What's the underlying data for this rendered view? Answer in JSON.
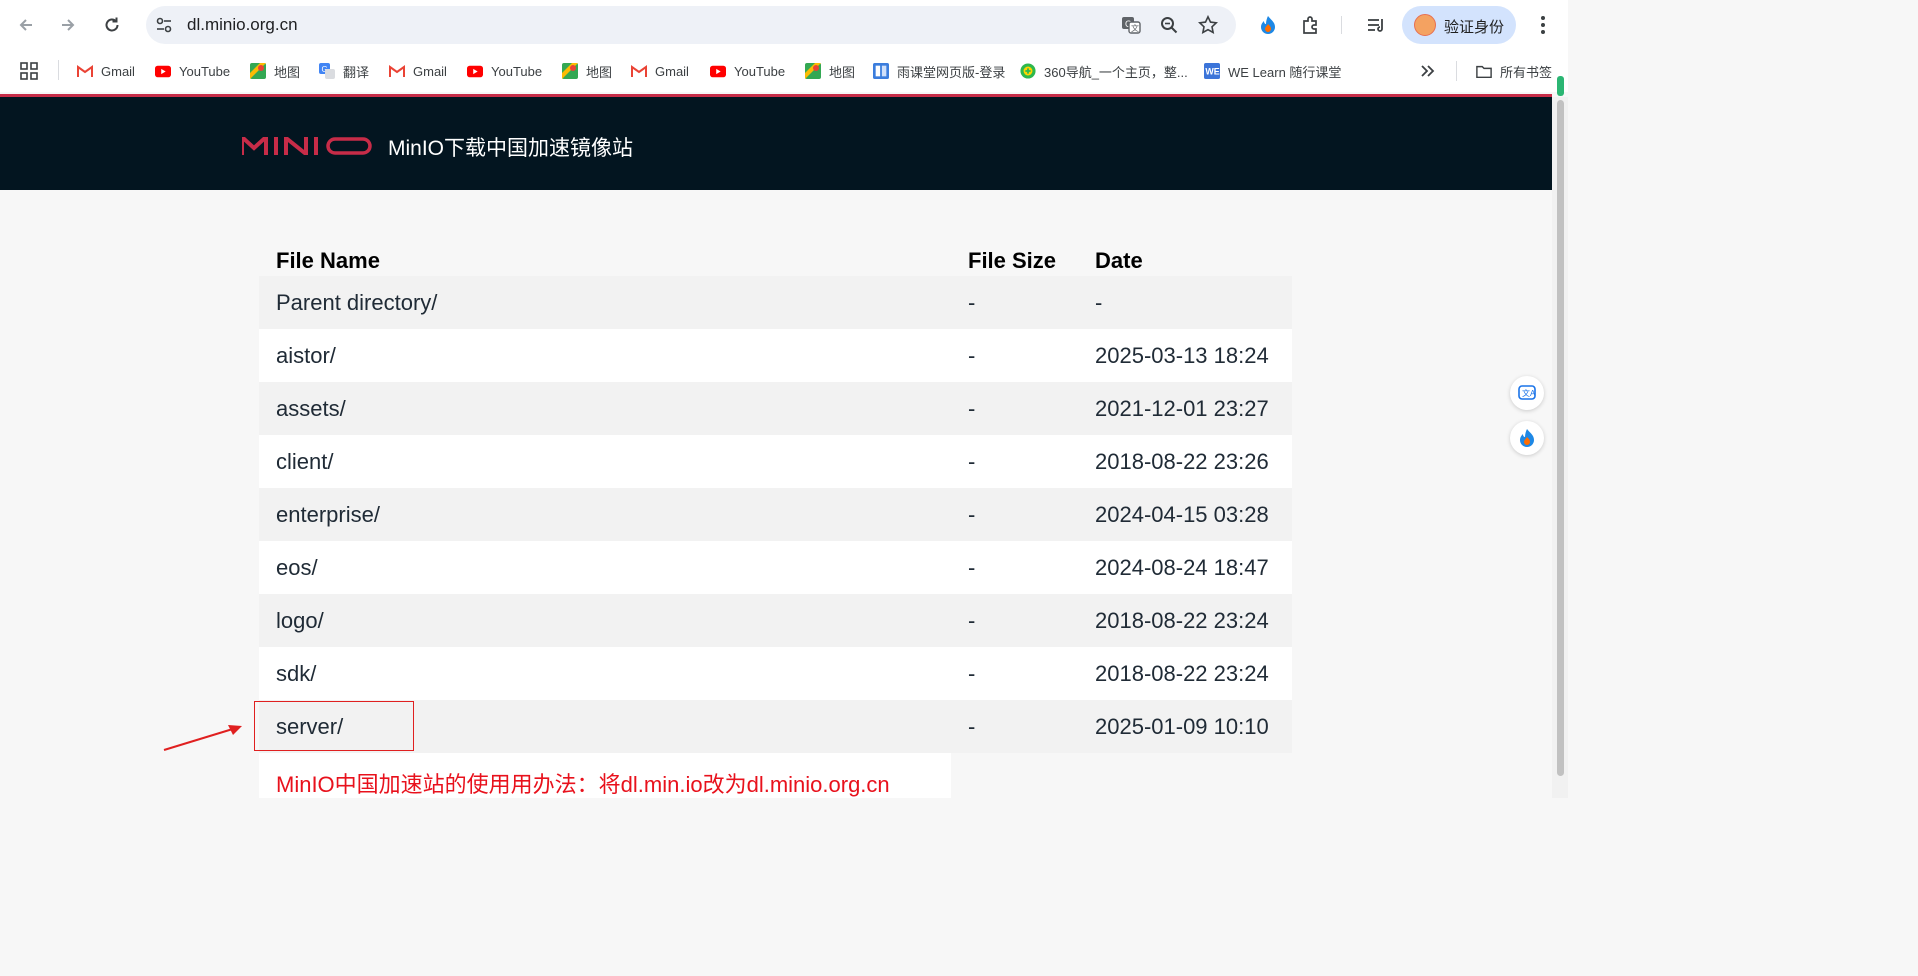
{
  "browser": {
    "url": "dl.minio.org.cn",
    "profile_label": "验证身份",
    "bookmarks": [
      {
        "label": "Gmail",
        "icon": "gmail-icon"
      },
      {
        "label": "YouTube",
        "icon": "youtube-icon"
      },
      {
        "label": "地图",
        "icon": "maps-icon"
      },
      {
        "label": "翻译",
        "icon": "translate-icon"
      },
      {
        "label": "Gmail",
        "icon": "gmail-icon"
      },
      {
        "label": "YouTube",
        "icon": "youtube-icon"
      },
      {
        "label": "地图",
        "icon": "maps-icon"
      },
      {
        "label": "Gmail",
        "icon": "gmail-icon"
      },
      {
        "label": "YouTube",
        "icon": "youtube-icon"
      },
      {
        "label": "地图",
        "icon": "maps-icon"
      },
      {
        "label": "雨课堂网页版-登录",
        "icon": "rain-classroom-icon"
      },
      {
        "label": "360导航_一个主页，整...",
        "icon": "360-icon"
      },
      {
        "label": "WE Learn 随行课堂",
        "icon": "welearn-icon"
      }
    ],
    "all_bookmarks_label": "所有书签"
  },
  "site": {
    "logo_text": "MINIO",
    "title": "MinIO下载中国加速镜像站"
  },
  "table": {
    "headers": {
      "name": "File Name",
      "size": "File Size",
      "date": "Date"
    },
    "rows": [
      {
        "name": "Parent directory/",
        "size": "-",
        "date": "-"
      },
      {
        "name": "aistor/",
        "size": "-",
        "date": "2025-03-13 18:24"
      },
      {
        "name": "assets/",
        "size": "-",
        "date": "2021-12-01 23:27"
      },
      {
        "name": "client/",
        "size": "-",
        "date": "2018-08-22 23:26"
      },
      {
        "name": "enterprise/",
        "size": "-",
        "date": "2024-04-15 03:28"
      },
      {
        "name": "eos/",
        "size": "-",
        "date": "2024-08-24 18:47"
      },
      {
        "name": "logo/",
        "size": "-",
        "date": "2018-08-22 23:24"
      },
      {
        "name": "sdk/",
        "size": "-",
        "date": "2018-08-22 23:24"
      },
      {
        "name": "server/",
        "size": "-",
        "date": "2025-01-09 10:10"
      }
    ]
  },
  "note": "MinIO中国加速站的使用用办法：将dl.min.io改为dl.minio.org.cn",
  "colors": {
    "header_bg": "#031520",
    "brand_red": "#c72c48",
    "note_red": "#e8111c",
    "highlight_red": "#e02020"
  }
}
